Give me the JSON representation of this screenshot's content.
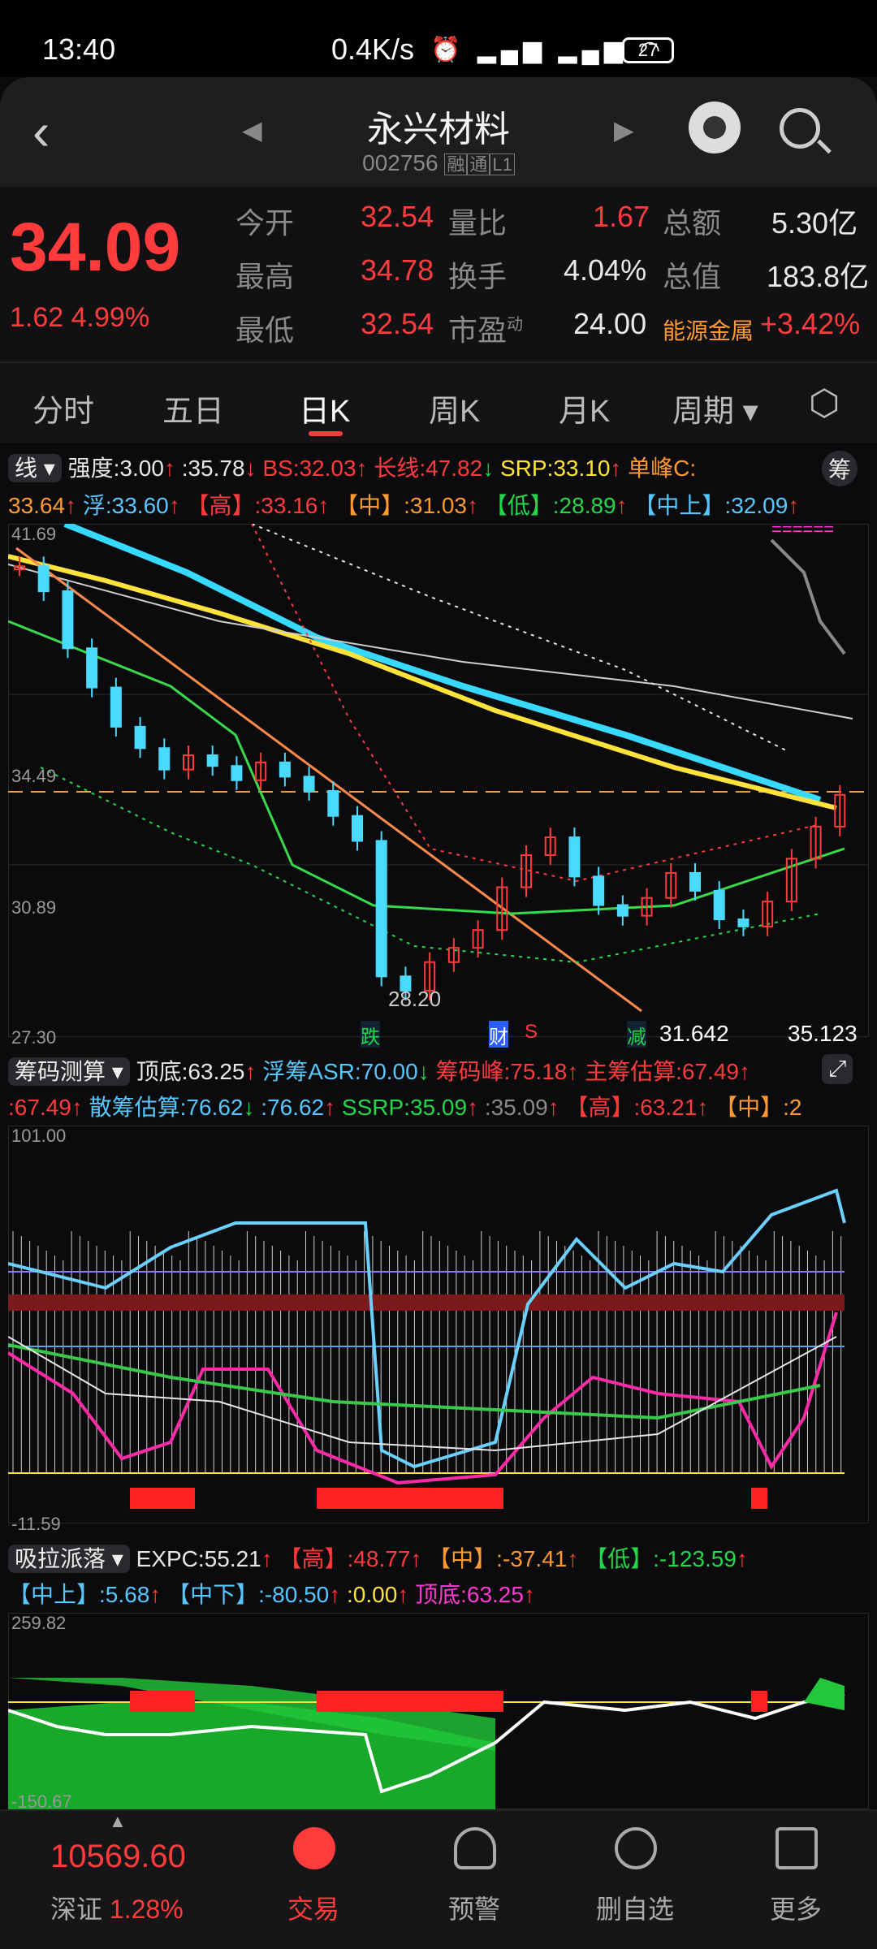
{
  "status": {
    "time": "13:40",
    "speed": "0.4K/s",
    "battery": "27"
  },
  "header": {
    "title": "永兴材料",
    "code": "002756",
    "badges": [
      "融",
      "通",
      "L1"
    ]
  },
  "quote": {
    "price": "34.09",
    "change": "1.62",
    "change_pct": "4.99%",
    "stats": [
      {
        "label": "今开",
        "value": "32.54"
      },
      {
        "label": "量比",
        "value": "1.67"
      },
      {
        "label": "总额",
        "value": "5.30亿"
      },
      {
        "label": "最高",
        "value": "34.78"
      },
      {
        "label": "换手",
        "value": "4.04%"
      },
      {
        "label": "总值",
        "value": "183.8亿"
      },
      {
        "label": "最低",
        "value": "32.54"
      },
      {
        "label": "市盈",
        "value": "24.00"
      },
      {
        "label": "能源金属",
        "value": "+3.42%"
      }
    ],
    "pe_sup": "动"
  },
  "tabs": [
    "分时",
    "五日",
    "日K",
    "周K",
    "月K",
    "周期"
  ],
  "panel1": {
    "selector": "线",
    "row1": [
      "强度:3.00",
      ":35.78",
      "BS:32.03",
      "长线:47.82",
      "SRP:33.10",
      "单峰C:"
    ],
    "row2": [
      "33.64",
      "浮:33.60",
      "【高】:33.16",
      "【中】:31.03",
      "【低】:28.89",
      "【中上】:32.09"
    ],
    "button": "筹",
    "axis": [
      "41.69",
      "34.49",
      "30.89",
      "27.30"
    ],
    "low_label": "28.20",
    "marks": [
      "跌",
      "财",
      "S",
      "减"
    ],
    "bottom_right": [
      "31.642",
      "35.123"
    ]
  },
  "panel2": {
    "selector": "筹码测算",
    "row1": [
      "顶底:63.25",
      "浮筹ASR:70.00",
      "筹码峰:75.18",
      "主筹估算:67.49"
    ],
    "row2": [
      ":67.49",
      "散筹估算:76.62",
      ":76.62",
      "SSRP:35.09",
      ":35.09",
      "【高】:63.21",
      "【中】:2"
    ],
    "axis": [
      "101.00",
      "-11.59"
    ]
  },
  "panel3": {
    "selector": "吸拉派落",
    "row1": [
      "EXPC:55.21",
      "【高】:48.77",
      "【中】:-37.41",
      "【低】:-123.59"
    ],
    "row2": [
      "【中上】:5.68",
      "【中下】:-80.50",
      ":0.00",
      "顶底:63.25"
    ],
    "axis": [
      "259.82",
      "-150.67"
    ]
  },
  "bottom": {
    "index_value": "10569.60",
    "index_name": "深证",
    "index_pct": "1.28%",
    "nav": [
      "交易",
      "预警",
      "删自选",
      "更多"
    ]
  },
  "chart_data": {
    "type": "line",
    "title": "",
    "ylim": [
      27.3,
      41.69
    ],
    "series": [
      {
        "values": [
          40.5,
          39.8,
          38.2,
          37.1,
          36.0,
          35.4,
          34.8,
          35.2,
          34.9,
          34.5,
          35.0,
          34.6,
          34.2,
          33.5,
          32.8,
          29.0,
          28.6,
          29.4,
          29.8,
          30.3,
          31.5,
          32.4,
          32.9,
          31.8,
          31.0,
          30.7,
          31.2,
          31.9,
          31.4,
          30.6,
          30.4,
          31.1,
          32.3,
          33.2,
          34.09
        ]
      }
    ]
  }
}
